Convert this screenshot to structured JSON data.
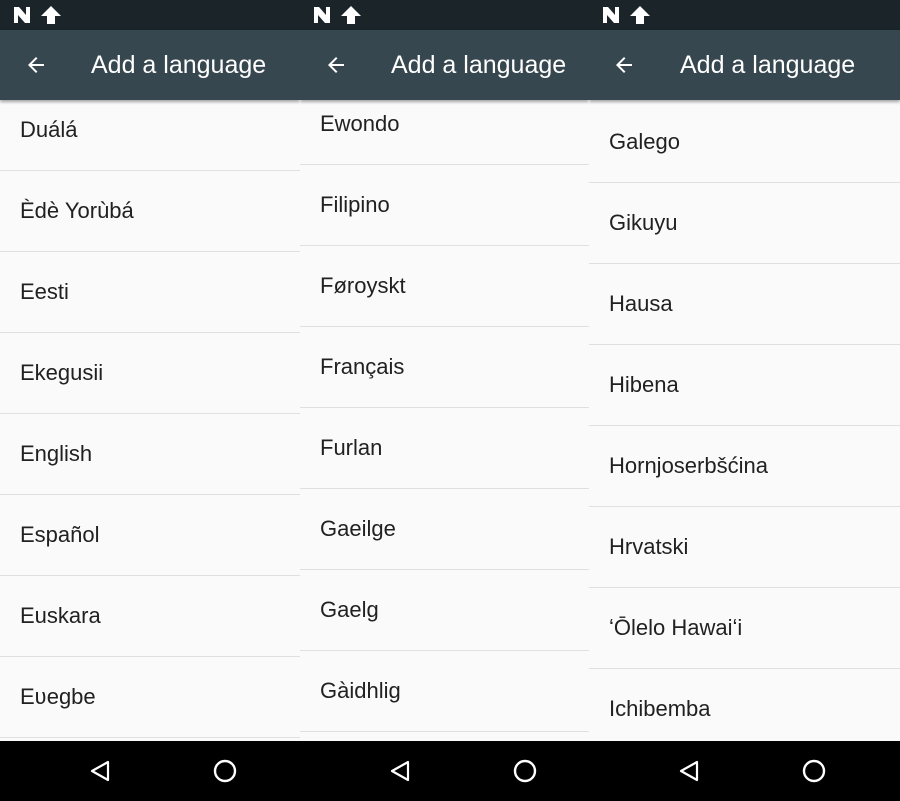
{
  "app": {
    "title": "Add a language"
  },
  "icons": {
    "status_n": "n-notification-icon",
    "status_upload": "upload-arrow-icon",
    "back": "arrow-left-icon",
    "nav_back": "triangle-back-icon",
    "nav_home": "circle-home-icon"
  },
  "colors": {
    "status_bar": "#1b2529",
    "toolbar": "#37474f",
    "list_background": "#fafafa",
    "divider": "#e0e0e0",
    "text": "#212121",
    "nav_bar": "#000000"
  },
  "screens": [
    {
      "languages": [
        "Duálá",
        "Èdè Yorùbá",
        "Eesti",
        "Ekegusii",
        "English",
        "Español",
        "Euskara",
        "Eʋegbe"
      ]
    },
    {
      "languages": [
        "Ewondo",
        "Filipino",
        "Føroyskt",
        "Français",
        "Furlan",
        "Gaeilge",
        "Gaelg",
        "Gàidhlig"
      ]
    },
    {
      "languages": [
        "Galego",
        "Gikuyu",
        "Hausa",
        "Hibena",
        "Hornjoserbšćina",
        "Hrvatski",
        "ʻŌlelo Hawaiʻi",
        "Ichibemba"
      ]
    }
  ]
}
